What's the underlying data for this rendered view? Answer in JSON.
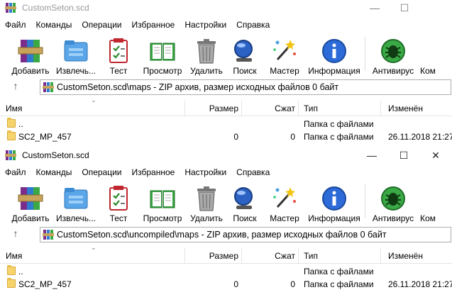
{
  "windows": [
    {
      "title": "CustomSeton.scd",
      "menu": [
        "Файл",
        "Команды",
        "Операции",
        "Избранное",
        "Настройки",
        "Справка"
      ],
      "toolbar": [
        "Добавить",
        "Извлечь...",
        "Тест",
        "Просмотр",
        "Удалить",
        "Поиск",
        "Мастер",
        "Информация",
        "Антивирус",
        "Ком"
      ],
      "address": "CustomSeton.scd\\maps - ZIP архив, размер исходных файлов 0 байт",
      "columns": {
        "name": "Имя",
        "size": "Размер",
        "packed": "Сжат",
        "type": "Тип",
        "modified": "Изменён"
      },
      "rows": [
        {
          "name": "..",
          "size": "",
          "packed": "",
          "type": "Папка с файлами",
          "modified": ""
        },
        {
          "name": "SC2_MP_457",
          "size": "0",
          "packed": "0",
          "type": "Папка с файлами",
          "modified": "26.11.2018 21:27"
        }
      ]
    },
    {
      "title": "CustomSeton.scd",
      "menu": [
        "Файл",
        "Команды",
        "Операции",
        "Избранное",
        "Настройки",
        "Справка"
      ],
      "toolbar": [
        "Добавить",
        "Извлечь...",
        "Тест",
        "Просмотр",
        "Удалить",
        "Поиск",
        "Мастер",
        "Информация",
        "Антивирус",
        "Ком"
      ],
      "address": "CustomSeton.scd\\uncompiled\\maps - ZIP архив, размер исходных файлов 0 байт",
      "columns": {
        "name": "Имя",
        "size": "Размер",
        "packed": "Сжат",
        "type": "Тип",
        "modified": "Изменён"
      },
      "rows": [
        {
          "name": "..",
          "size": "",
          "packed": "",
          "type": "Папка с файлами",
          "modified": ""
        },
        {
          "name": "SC2_MP_457",
          "size": "0",
          "packed": "0",
          "type": "Папка с файлами",
          "modified": "26.11.2018 21:27"
        }
      ]
    }
  ]
}
